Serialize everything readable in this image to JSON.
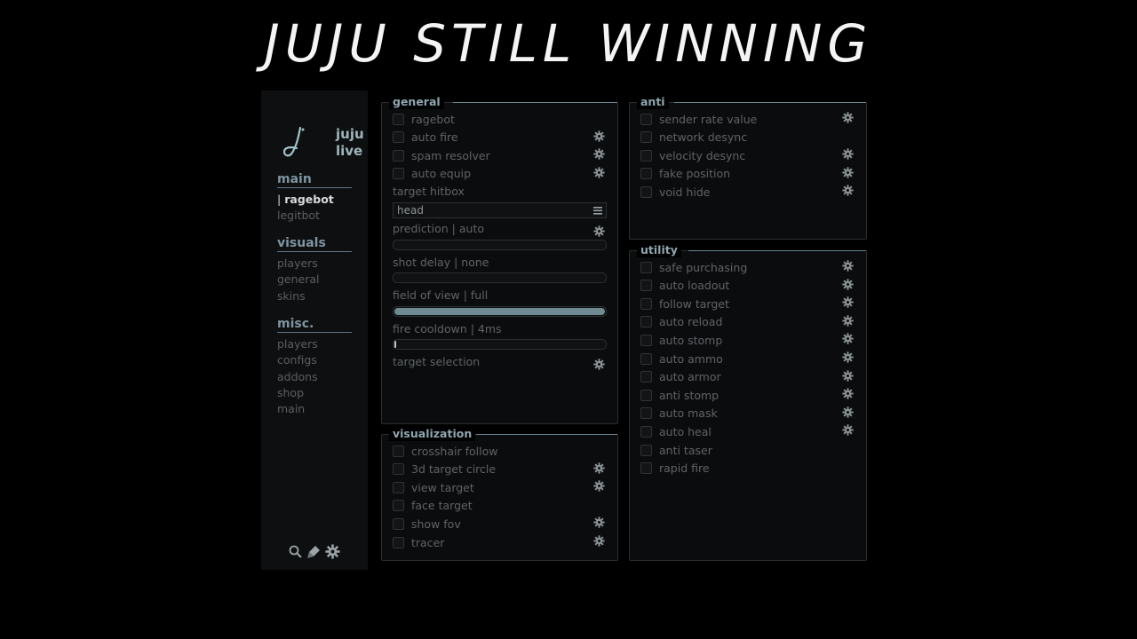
{
  "banner": {
    "text": "JUJU STILL WINNING"
  },
  "sidebar": {
    "logo_line1": "juju",
    "logo_line2": "live",
    "sections": [
      {
        "title": "main",
        "items": [
          "ragebot",
          "legitbot"
        ],
        "active": "ragebot"
      },
      {
        "title": "visuals",
        "items": [
          "players",
          "general",
          "skins"
        ]
      },
      {
        "title": "misc.",
        "items": [
          "players",
          "configs",
          "addons",
          "shop",
          "main"
        ]
      }
    ],
    "footer_icons": [
      "search-icon",
      "brush-icon",
      "gear-icon"
    ]
  },
  "general": {
    "title": "general",
    "toggles": [
      {
        "label": "ragebot",
        "gear": false
      },
      {
        "label": "auto fire",
        "gear": true
      },
      {
        "label": "spam resolver",
        "gear": true
      },
      {
        "label": "auto equip",
        "gear": true
      }
    ],
    "target_hitbox_label": "target hitbox",
    "target_hitbox_value": "head",
    "prediction_label": "prediction | auto",
    "shot_delay_label": "shot delay | none",
    "fov_label": "field of view | full",
    "fov_level": 1.0,
    "fire_cooldown_label": "fire cooldown | 4ms",
    "fire_cooldown_level": 0.01,
    "target_selection_label": "target selection"
  },
  "visualization": {
    "title": "visualization",
    "toggles": [
      {
        "label": "crosshair follow",
        "gear": false
      },
      {
        "label": "3d target circle",
        "gear": true
      },
      {
        "label": "view target",
        "gear": true
      },
      {
        "label": "face target",
        "gear": false
      },
      {
        "label": "show fov",
        "gear": true
      },
      {
        "label": "tracer",
        "gear": true
      }
    ]
  },
  "anti": {
    "title": "anti",
    "toggles": [
      {
        "label": "sender rate value",
        "gear": true
      },
      {
        "label": "network desync",
        "gear": false
      },
      {
        "label": "velocity desync",
        "gear": true
      },
      {
        "label": "fake position",
        "gear": true
      },
      {
        "label": "void hide",
        "gear": true
      }
    ]
  },
  "utility": {
    "title": "utility",
    "toggles": [
      {
        "label": "safe purchasing",
        "gear": true
      },
      {
        "label": "auto loadout",
        "gear": true
      },
      {
        "label": "follow target",
        "gear": true
      },
      {
        "label": "auto reload",
        "gear": true
      },
      {
        "label": "auto stomp",
        "gear": true
      },
      {
        "label": "auto ammo",
        "gear": true
      },
      {
        "label": "auto armor",
        "gear": true
      },
      {
        "label": "anti stomp",
        "gear": true
      },
      {
        "label": "auto mask",
        "gear": true
      },
      {
        "label": "auto heal",
        "gear": true
      },
      {
        "label": "anti taser",
        "gear": false
      },
      {
        "label": "rapid fire",
        "gear": false
      }
    ]
  },
  "colors": {
    "accent": "#6f8a90",
    "panel_bg": "#0b0c0d",
    "sidebar_bg": "#0e0f10"
  }
}
